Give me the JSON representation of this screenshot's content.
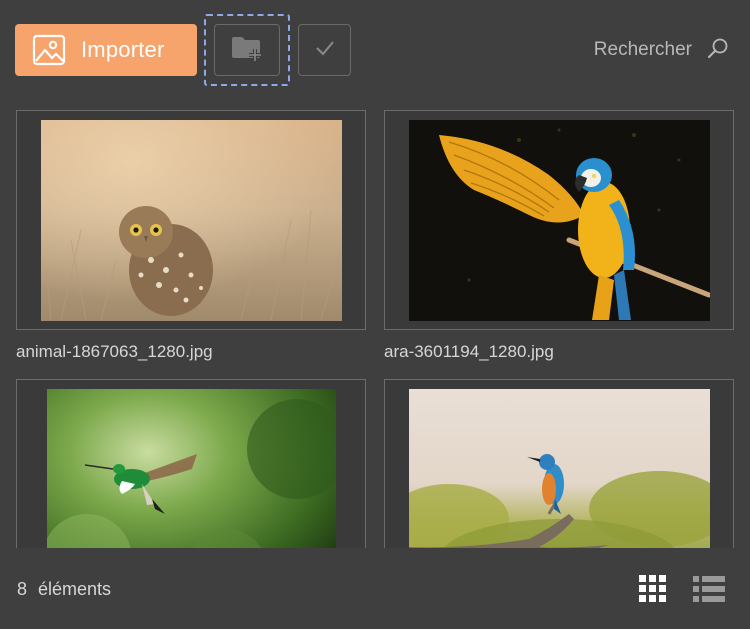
{
  "toolbar": {
    "import_label": "Importer",
    "import_icon": "image-icon",
    "new_folder_icon": "folder-add-icon",
    "select_icon": "checkmark-icon",
    "search_placeholder": "Rechercher",
    "search_icon": "search-icon",
    "accent_color": "#f6a46c"
  },
  "gallery": {
    "items": [
      {
        "filename": "animal-1867063_1280.jpg",
        "subject": "owl"
      },
      {
        "filename": "ara-3601194_1280.jpg",
        "subject": "macaw"
      },
      {
        "filename": "",
        "subject": "hummingbird"
      },
      {
        "filename": "",
        "subject": "kingfisher"
      }
    ]
  },
  "footer": {
    "count_label": "8  éléments",
    "grid_view_icon": "grid-view-icon",
    "list_view_icon": "list-view-icon"
  }
}
